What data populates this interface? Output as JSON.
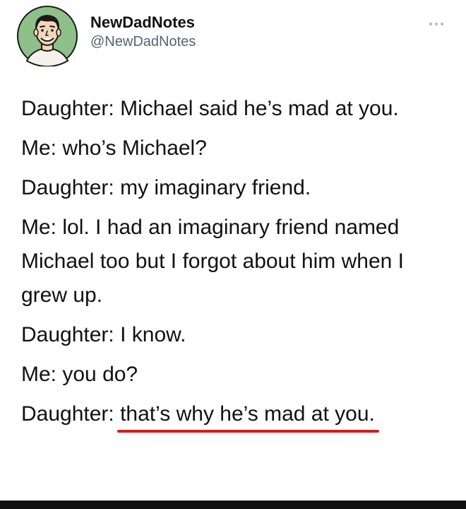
{
  "tweet": {
    "author": {
      "display_name": "NewDadNotes",
      "handle": "@NewDadNotes",
      "avatar_icon": "cartoon-man-avatar-icon",
      "avatar_bg": "#8fc08a"
    },
    "more_icon": "more-options-icon",
    "lines": [
      {
        "speaker": "Daughter:",
        "text": "Michael said he’s mad at you."
      },
      {
        "speaker": "Me:",
        "text": "who’s Michael?"
      },
      {
        "speaker": "Daughter:",
        "text": "my imaginary friend."
      },
      {
        "speaker": "Me:",
        "text": "lol. I had an imaginary friend named Michael too but I forgot about him when I grew up."
      },
      {
        "speaker": "Daughter:",
        "text": "I know."
      },
      {
        "speaker": "Me:",
        "text": "you do?"
      },
      {
        "speaker": "Daughter:",
        "text": "that’s why he’s mad at you."
      }
    ],
    "underline_color": "#d61a1a"
  }
}
